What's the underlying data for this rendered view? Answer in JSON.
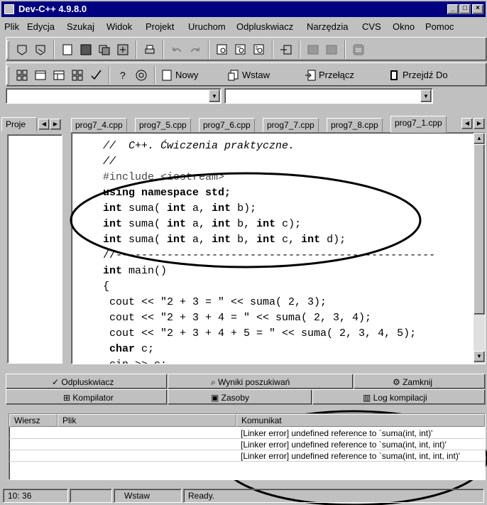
{
  "window": {
    "title": "Dev-C++ 4.9.8.0"
  },
  "menu": [
    "Plik",
    "Edycja",
    "Szukaj",
    "Widok",
    "Projekt",
    "Uruchom",
    "Odpluskwiacz",
    "Narzędzia",
    "CVS",
    "Okno",
    "Pomoc"
  ],
  "toolbar2": {
    "new_label": "Nowy",
    "insert_label": "Wstaw",
    "toggle_label": "Przełącz",
    "goto_label": "Przejdź Do"
  },
  "project_panel": {
    "label": "Proje"
  },
  "tabs": [
    "prog7_4.cpp",
    "prog7_5.cpp",
    "prog7_6.cpp",
    "prog7_7.cpp",
    "prog7_8.cpp",
    "prog7_1.cpp"
  ],
  "code": [
    "//  C++. Ćwiczenia praktyczne.",
    "//",
    "#include <iostream>",
    "using namespace std;",
    "int suma( int a, int b);",
    "int suma( int a, int b, int c);",
    "int suma( int a, int b, int c, int d);",
    "//--------------------------------------------------",
    "int main()",
    "{",
    " cout << \"2 + 3 = \" << suma( 2, 3);",
    " cout << \"2 + 3 + 4 = \" << suma( 2, 3, 4);",
    " cout << \"2 + 3 + 4 + 5 = \" << suma( 2, 3, 4, 5);",
    " char c;",
    " cin >> c;"
  ],
  "bottom_tabs_back": {
    "debugger": "Odpluskwiacz",
    "search_results": "Wyniki poszukiwań",
    "close": "Zamknij"
  },
  "bottom_tabs_front": {
    "compiler": "Kompilator",
    "resources": "Zasoby",
    "compile_log": "Log kompilacji"
  },
  "messages": {
    "headers": {
      "line": "Wiersz",
      "file": "Plik",
      "message": "Komunikat"
    },
    "rows": [
      {
        "line": "",
        "file": "",
        "message": "[Linker error] undefined reference to `suma(int, int)'"
      },
      {
        "line": "",
        "file": "",
        "message": "[Linker error] undefined reference to `suma(int, int, int)'"
      },
      {
        "line": "",
        "file": "",
        "message": "[Linker error] undefined reference to `suma(int, int, int, int)'"
      }
    ]
  },
  "status": {
    "position": "10: 36",
    "mode": "Wstaw",
    "state": "Ready."
  },
  "colors": {
    "titlebar": "#000080",
    "face": "#c0c0c0",
    "annotation": "#000000"
  }
}
